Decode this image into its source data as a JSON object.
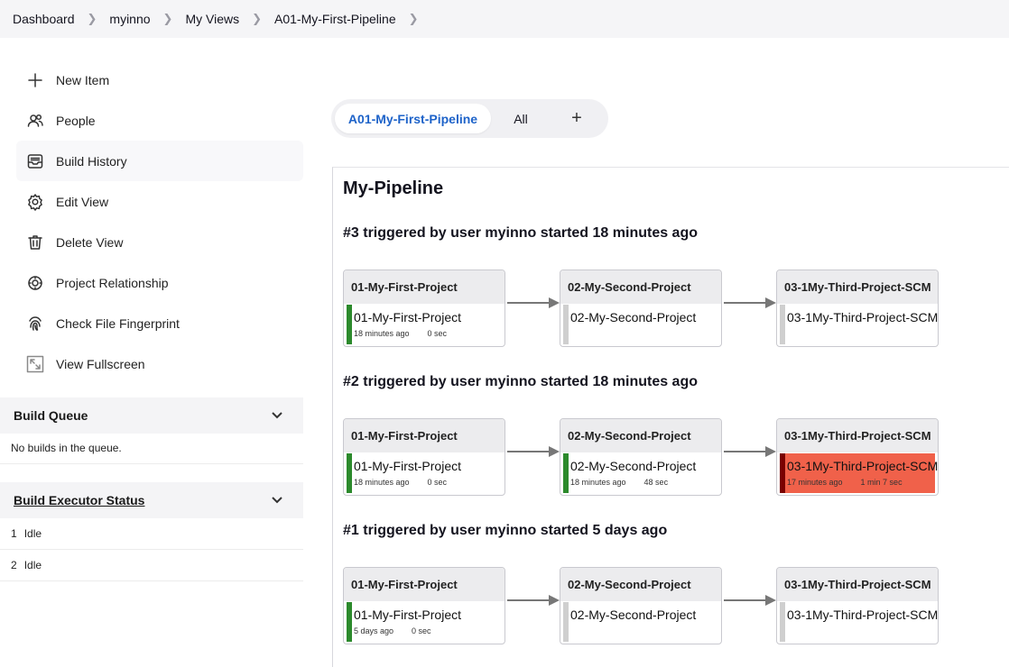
{
  "breadcrumb": [
    "Dashboard",
    "myinno",
    "My Views",
    "A01-My-First-Pipeline"
  ],
  "sidebar": {
    "tasks": [
      {
        "label": "New Item",
        "icon": "plus-icon"
      },
      {
        "label": "People",
        "icon": "people-icon"
      },
      {
        "label": "Build History",
        "icon": "inbox-icon"
      },
      {
        "label": "Edit View",
        "icon": "gear-icon"
      },
      {
        "label": "Delete View",
        "icon": "trash-icon"
      },
      {
        "label": "Project Relationship",
        "icon": "relationship-icon"
      },
      {
        "label": "Check File Fingerprint",
        "icon": "fingerprint-icon"
      },
      {
        "label": "View Fullscreen",
        "icon": "fullscreen-icon"
      }
    ]
  },
  "build_queue": {
    "title": "Build Queue",
    "empty_text": "No builds in the queue."
  },
  "executor_status": {
    "title": "Build Executor Status",
    "executors": [
      {
        "num": "1",
        "status": "Idle"
      },
      {
        "num": "2",
        "status": "Idle"
      }
    ]
  },
  "tabs": {
    "active": "A01-My-First-Pipeline",
    "other": "All",
    "add": "+"
  },
  "view_title": "My-Pipeline",
  "builds": [
    {
      "title": "#3 triggered by user myinno started 18 minutes ago",
      "stages": [
        {
          "header": "01-My-First-Project",
          "name": "01-My-First-Project",
          "status": "success",
          "time": "18 minutes ago",
          "duration": "0 sec"
        },
        {
          "header": "02-My-Second-Project",
          "name": "02-My-Second-Project",
          "status": "pending",
          "time": "",
          "duration": ""
        },
        {
          "header": "03-1My-Third-Project-SCM",
          "name": "03-1My-Third-Project-SCM",
          "status": "pending",
          "time": "",
          "duration": ""
        }
      ]
    },
    {
      "title": "#2 triggered by user myinno started 18 minutes ago",
      "stages": [
        {
          "header": "01-My-First-Project",
          "name": "01-My-First-Project",
          "status": "success",
          "time": "18 minutes ago",
          "duration": "0 sec"
        },
        {
          "header": "02-My-Second-Project",
          "name": "02-My-Second-Project",
          "status": "success",
          "time": "18 minutes ago",
          "duration": "48 sec"
        },
        {
          "header": "03-1My-Third-Project-SCM",
          "name": "03-1My-Third-Project-SCM",
          "status": "failed",
          "time": "17 minutes ago",
          "duration": "1 min 7 sec"
        }
      ]
    },
    {
      "title": "#1 triggered by user myinno started 5 days ago",
      "stages": [
        {
          "header": "01-My-First-Project",
          "name": "01-My-First-Project",
          "status": "success",
          "time": "5 days ago",
          "duration": "0 sec"
        },
        {
          "header": "02-My-Second-Project",
          "name": "02-My-Second-Project",
          "status": "pending",
          "time": "",
          "duration": ""
        },
        {
          "header": "03-1My-Third-Project-SCM",
          "name": "03-1My-Third-Project-SCM",
          "status": "pending",
          "time": "",
          "duration": ""
        }
      ]
    }
  ],
  "colors": {
    "success": "#2c8a2c",
    "failed_bg": "#f0614a",
    "failed_bar": "#7a0000",
    "pending": "#cfcfcf",
    "accent": "#1e63c9"
  }
}
